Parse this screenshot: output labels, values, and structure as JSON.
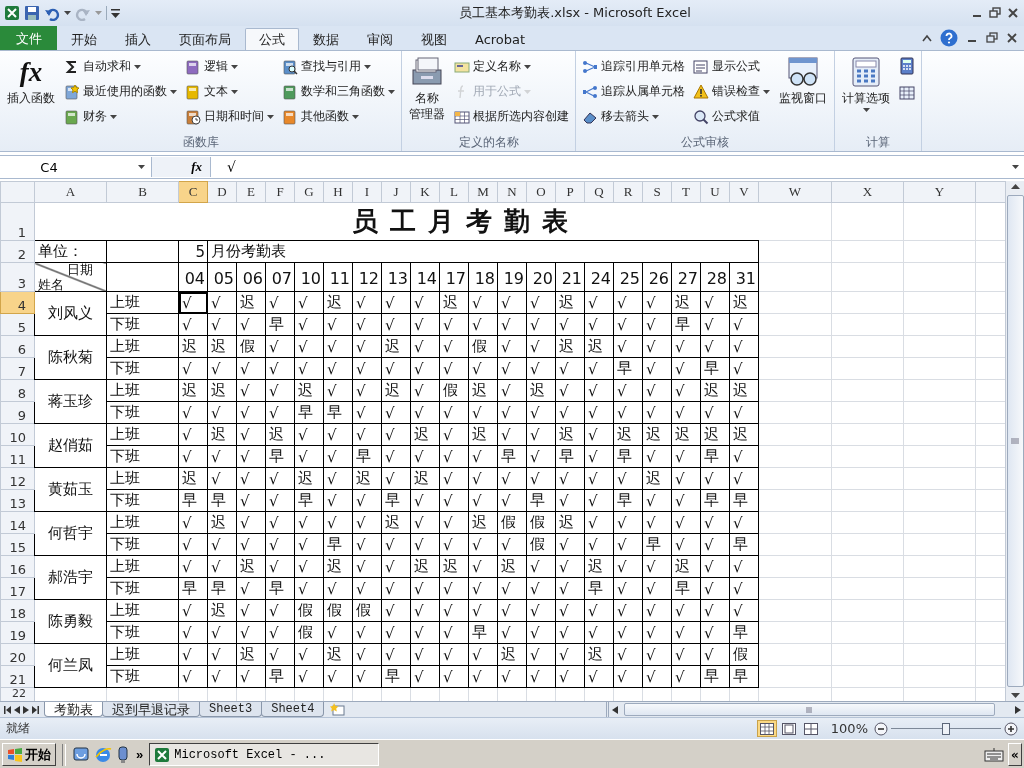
{
  "window": {
    "title": "员工基本考勤表.xlsx - Microsoft Excel"
  },
  "ribbon_tabs": [
    {
      "label": "文件",
      "kind": "file",
      "selected": false
    },
    {
      "label": "开始",
      "kind": "tab",
      "selected": false
    },
    {
      "label": "插入",
      "kind": "tab",
      "selected": false
    },
    {
      "label": "页面布局",
      "kind": "tab",
      "selected": false
    },
    {
      "label": "公式",
      "kind": "tab",
      "selected": true
    },
    {
      "label": "数据",
      "kind": "tab",
      "selected": false
    },
    {
      "label": "审阅",
      "kind": "tab",
      "selected": false
    },
    {
      "label": "视图",
      "kind": "tab",
      "selected": false
    },
    {
      "label": "Acrobat",
      "kind": "tab",
      "selected": false
    }
  ],
  "ribbon_groups": [
    {
      "label": "函数库",
      "controls": [
        {
          "kind": "large",
          "label": "插入函数",
          "glyph": "fx",
          "dropdown": false
        },
        {
          "kind": "column",
          "items": [
            {
              "kind": "small",
              "label": "自动求和",
              "dropdown": true,
              "disabled": false
            },
            {
              "kind": "small",
              "label": "最近使用的函数",
              "dropdown": true,
              "disabled": false
            },
            {
              "kind": "small",
              "label": "财务",
              "dropdown": true,
              "disabled": false
            }
          ]
        },
        {
          "kind": "column",
          "items": [
            {
              "kind": "small",
              "label": "逻辑",
              "dropdown": true,
              "disabled": false
            },
            {
              "kind": "small",
              "label": "文本",
              "dropdown": true,
              "disabled": false
            },
            {
              "kind": "small",
              "label": "日期和时间",
              "dropdown": true,
              "disabled": false
            }
          ]
        },
        {
          "kind": "column",
          "items": [
            {
              "kind": "small",
              "label": "查找与引用",
              "dropdown": true,
              "disabled": false
            },
            {
              "kind": "small",
              "label": "数学和三角函数",
              "dropdown": true,
              "disabled": false
            },
            {
              "kind": "small",
              "label": "其他函数",
              "dropdown": true,
              "disabled": false
            }
          ]
        }
      ]
    },
    {
      "label": "定义的名称",
      "controls": [
        {
          "kind": "large",
          "label_lines": [
            "名称",
            "管理器"
          ],
          "dropdown": false
        },
        {
          "kind": "column",
          "items": [
            {
              "kind": "small",
              "label": "定义名称",
              "dropdown": true,
              "disabled": false
            },
            {
              "kind": "small",
              "label": "用于公式",
              "dropdown": true,
              "disabled": true
            },
            {
              "kind": "small",
              "label": "根据所选内容创建",
              "dropdown": false,
              "disabled": false
            }
          ]
        }
      ]
    },
    {
      "label": "公式审核",
      "controls": [
        {
          "kind": "column",
          "items": [
            {
              "kind": "small",
              "label": "追踪引用单元格",
              "dropdown": false,
              "disabled": false
            },
            {
              "kind": "small",
              "label": "追踪从属单元格",
              "dropdown": false,
              "disabled": false
            },
            {
              "kind": "small",
              "label": "移去箭头",
              "dropdown": true,
              "disabled": false
            }
          ]
        },
        {
          "kind": "column",
          "items": [
            {
              "kind": "small",
              "label": "显示公式",
              "dropdown": false,
              "disabled": false
            },
            {
              "kind": "small",
              "label": "错误检查",
              "dropdown": true,
              "disabled": false
            },
            {
              "kind": "small",
              "label": "公式求值",
              "dropdown": false,
              "disabled": false
            }
          ]
        },
        {
          "kind": "large",
          "label": "监视窗口",
          "dropdown": false
        }
      ]
    },
    {
      "label": "计算",
      "controls": [
        {
          "kind": "large",
          "label": "计算选项",
          "dropdown": true
        },
        {
          "kind": "column",
          "items": [
            {
              "kind": "icon",
              "dropdown": false,
              "disabled": false
            },
            {
              "kind": "icon",
              "dropdown": false,
              "disabled": false
            }
          ]
        }
      ]
    }
  ],
  "formula_bar": {
    "name_box": "C4",
    "glyph": "fx",
    "formula": "√"
  },
  "columns": [
    {
      "label": "A",
      "selected": false
    },
    {
      "label": "B",
      "selected": false
    },
    {
      "label": "C",
      "selected": true
    },
    {
      "label": "D",
      "selected": false
    },
    {
      "label": "E",
      "selected": false
    },
    {
      "label": "F",
      "selected": false
    },
    {
      "label": "G",
      "selected": false
    },
    {
      "label": "H",
      "selected": false
    },
    {
      "label": "I",
      "selected": false
    },
    {
      "label": "J",
      "selected": false
    },
    {
      "label": "K",
      "selected": false
    },
    {
      "label": "L",
      "selected": false
    },
    {
      "label": "M",
      "selected": false
    },
    {
      "label": "N",
      "selected": false
    },
    {
      "label": "O",
      "selected": false
    },
    {
      "label": "P",
      "selected": false
    },
    {
      "label": "Q",
      "selected": false
    },
    {
      "label": "R",
      "selected": false
    },
    {
      "label": "S",
      "selected": false
    },
    {
      "label": "T",
      "selected": false
    },
    {
      "label": "U",
      "selected": false
    },
    {
      "label": "V",
      "selected": false
    },
    {
      "label": "W",
      "selected": false
    },
    {
      "label": "X",
      "selected": false
    },
    {
      "label": "Y",
      "selected": false
    }
  ],
  "rows": [
    {
      "label": "1",
      "selected": false
    },
    {
      "label": "2",
      "selected": false
    },
    {
      "label": "3",
      "selected": false
    },
    {
      "label": "4",
      "selected": true
    },
    {
      "label": "5",
      "selected": false
    },
    {
      "label": "6",
      "selected": false
    },
    {
      "label": "7",
      "selected": false
    },
    {
      "label": "8",
      "selected": false
    },
    {
      "label": "9",
      "selected": false
    },
    {
      "label": "10",
      "selected": false
    },
    {
      "label": "11",
      "selected": false
    },
    {
      "label": "12",
      "selected": false
    },
    {
      "label": "13",
      "selected": false
    },
    {
      "label": "14",
      "selected": false
    },
    {
      "label": "15",
      "selected": false
    },
    {
      "label": "16",
      "selected": false
    },
    {
      "label": "17",
      "selected": false
    },
    {
      "label": "18",
      "selected": false
    },
    {
      "label": "19",
      "selected": false
    },
    {
      "label": "20",
      "selected": false
    },
    {
      "label": "21",
      "selected": false
    },
    {
      "label": "22",
      "selected": false
    }
  ],
  "sheet": {
    "title": "员工月考勤表",
    "unit_label": "单位：",
    "month": "5",
    "month_label": "月份考勤表",
    "corner_top": "日期",
    "corner_bottom": "姓名",
    "dates": [
      "04",
      "05",
      "06",
      "07",
      "10",
      "11",
      "12",
      "13",
      "14",
      "17",
      "18",
      "19",
      "20",
      "21",
      "24",
      "25",
      "26",
      "27",
      "28",
      "31"
    ],
    "employees": [
      {
        "name": "刘风义",
        "shifts": [
          {
            "label": "上班",
            "marks": [
              "√",
              "√",
              "迟",
              "√",
              "√",
              "迟",
              "√",
              "√",
              "√",
              "迟",
              "√",
              "√",
              "√",
              "迟",
              "√",
              "√",
              "√",
              "迟",
              "√",
              "迟"
            ]
          },
          {
            "label": "下班",
            "marks": [
              "√",
              "√",
              "√",
              "早",
              "√",
              "√",
              "√",
              "√",
              "√",
              "√",
              "√",
              "√",
              "√",
              "√",
              "√",
              "√",
              "√",
              "早",
              "√",
              "√"
            ]
          }
        ]
      },
      {
        "name": "陈秋菊",
        "shifts": [
          {
            "label": "上班",
            "marks": [
              "迟",
              "迟",
              "假",
              "√",
              "√",
              "√",
              "√",
              "迟",
              "√",
              "√",
              "假",
              "√",
              "√",
              "迟",
              "迟",
              "√",
              "√",
              "√",
              "√",
              "√"
            ]
          },
          {
            "label": "下班",
            "marks": [
              "√",
              "√",
              "√",
              "√",
              "√",
              "√",
              "√",
              "√",
              "√",
              "√",
              "√",
              "√",
              "√",
              "√",
              "√",
              "早",
              "√",
              "√",
              "早",
              "√"
            ]
          }
        ]
      },
      {
        "name": "蒋玉珍",
        "shifts": [
          {
            "label": "上班",
            "marks": [
              "迟",
              "迟",
              "√",
              "√",
              "迟",
              "√",
              "√",
              "迟",
              "√",
              "假",
              "迟",
              "√",
              "迟",
              "√",
              "√",
              "√",
              "√",
              "√",
              "迟",
              "迟"
            ]
          },
          {
            "label": "下班",
            "marks": [
              "√",
              "√",
              "√",
              "√",
              "早",
              "早",
              "√",
              "√",
              "√",
              "√",
              "√",
              "√",
              "√",
              "√",
              "√",
              "√",
              "√",
              "√",
              "√",
              "√"
            ]
          }
        ]
      },
      {
        "name": "赵俏茹",
        "shifts": [
          {
            "label": "上班",
            "marks": [
              "√",
              "迟",
              "√",
              "迟",
              "√",
              "√",
              "√",
              "√",
              "迟",
              "√",
              "迟",
              "√",
              "√",
              "迟",
              "√",
              "迟",
              "迟",
              "迟",
              "迟",
              "迟"
            ]
          },
          {
            "label": "下班",
            "marks": [
              "√",
              "√",
              "√",
              "早",
              "√",
              "√",
              "早",
              "√",
              "√",
              "√",
              "√",
              "早",
              "√",
              "早",
              "√",
              "早",
              "√",
              "√",
              "早",
              "√"
            ]
          }
        ]
      },
      {
        "name": "黄茹玉",
        "shifts": [
          {
            "label": "上班",
            "marks": [
              "迟",
              "√",
              "√",
              "√",
              "迟",
              "√",
              "迟",
              "√",
              "迟",
              "√",
              "√",
              "√",
              "√",
              "√",
              "√",
              "√",
              "迟",
              "√",
              "√",
              "√"
            ]
          },
          {
            "label": "下班",
            "marks": [
              "早",
              "早",
              "√",
              "√",
              "早",
              "√",
              "√",
              "早",
              "√",
              "√",
              "√",
              "√",
              "早",
              "√",
              "√",
              "早",
              "√",
              "√",
              "早",
              "早"
            ]
          }
        ]
      },
      {
        "name": "何哲宇",
        "shifts": [
          {
            "label": "上班",
            "marks": [
              "√",
              "迟",
              "√",
              "√",
              "√",
              "√",
              "√",
              "迟",
              "√",
              "√",
              "迟",
              "假",
              "假",
              "迟",
              "√",
              "√",
              "√",
              "√",
              "√",
              "√"
            ]
          },
          {
            "label": "下班",
            "marks": [
              "√",
              "√",
              "√",
              "√",
              "√",
              "早",
              "√",
              "√",
              "√",
              "√",
              "√",
              "√",
              "假",
              "√",
              "√",
              "√",
              "早",
              "√",
              "√",
              "早"
            ]
          }
        ]
      },
      {
        "name": "郝浩宇",
        "shifts": [
          {
            "label": "上班",
            "marks": [
              "√",
              "√",
              "迟",
              "√",
              "√",
              "迟",
              "√",
              "√",
              "迟",
              "迟",
              "√",
              "迟",
              "√",
              "√",
              "迟",
              "√",
              "√",
              "迟",
              "√",
              "√"
            ]
          },
          {
            "label": "下班",
            "marks": [
              "早",
              "早",
              "√",
              "早",
              "√",
              "√",
              "√",
              "√",
              "√",
              "√",
              "√",
              "√",
              "√",
              "√",
              "早",
              "√",
              "√",
              "早",
              "√",
              "√"
            ]
          }
        ]
      },
      {
        "name": "陈勇毅",
        "shifts": [
          {
            "label": "上班",
            "marks": [
              "√",
              "迟",
              "√",
              "√",
              "假",
              "假",
              "假",
              "√",
              "√",
              "√",
              "√",
              "√",
              "√",
              "√",
              "√",
              "√",
              "√",
              "√",
              "√",
              "√"
            ]
          },
          {
            "label": "下班",
            "marks": [
              "√",
              "√",
              "√",
              "√",
              "假",
              "√",
              "√",
              "√",
              "√",
              "√",
              "早",
              "√",
              "√",
              "√",
              "√",
              "√",
              "√",
              "√",
              "√",
              "早"
            ]
          }
        ]
      },
      {
        "name": "何兰凤",
        "shifts": [
          {
            "label": "上班",
            "marks": [
              "√",
              "√",
              "迟",
              "√",
              "√",
              "迟",
              "√",
              "√",
              "√",
              "√",
              "√",
              "迟",
              "√",
              "√",
              "迟",
              "√",
              "√",
              "√",
              "√",
              "假"
            ]
          },
          {
            "label": "下班",
            "marks": [
              "√",
              "√",
              "√",
              "早",
              "√",
              "√",
              "√",
              "早",
              "√",
              "√",
              "√",
              "√",
              "√",
              "√",
              "√",
              "√",
              "√",
              "√",
              "早",
              "早"
            ]
          }
        ]
      }
    ]
  },
  "sheet_tabs": [
    {
      "label": "考勤表",
      "selected": true
    },
    {
      "label": "迟到早退记录",
      "selected": false
    },
    {
      "label": "Sheet3",
      "selected": false
    },
    {
      "label": "Sheet4",
      "selected": false
    }
  ],
  "status_bar": {
    "status": "就绪",
    "views": [
      {
        "selected": true
      },
      {
        "selected": false
      },
      {
        "selected": false
      }
    ],
    "zoom": "100%",
    "zoom_slider": {
      "level": 0.5
    }
  },
  "taskbar": {
    "start": "开始",
    "more": "»",
    "task": "Microsoft Excel - ...",
    "tray_toggle": "«"
  }
}
